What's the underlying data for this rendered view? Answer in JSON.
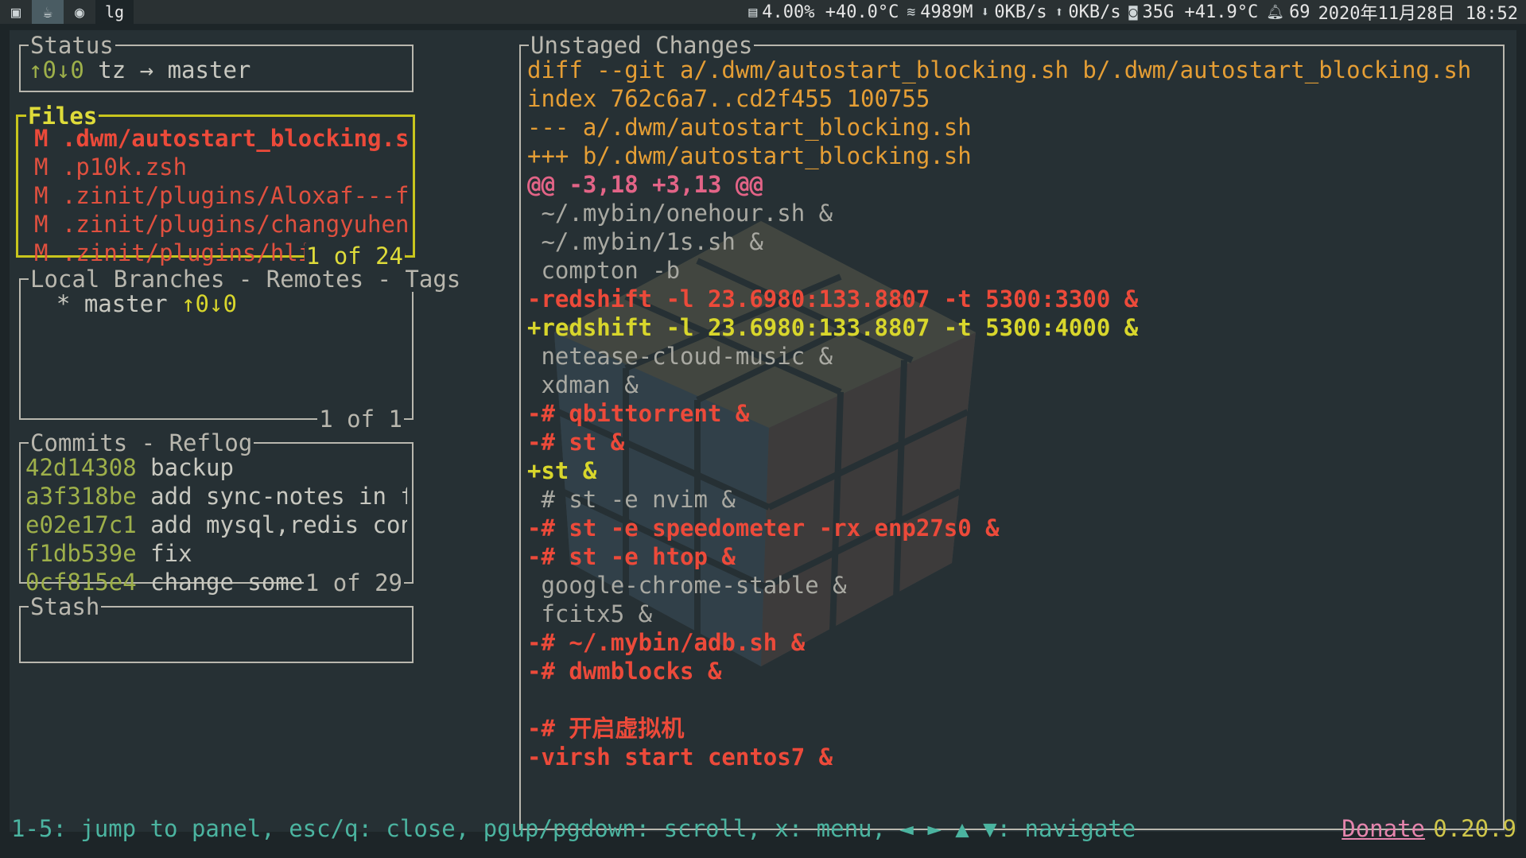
{
  "topbar": {
    "tags": [
      {
        "icon": "terminal-icon",
        "glyph": "▣"
      },
      {
        "icon": "coffee-icon",
        "glyph": "☕"
      },
      {
        "icon": "eye-icon",
        "glyph": "◉"
      }
    ],
    "window_title": "lg",
    "cpu": "4.00% +40.0°C",
    "mem": "4989M",
    "down": "0KB/s",
    "up": "0KB/s",
    "disk": "35G +41.9°C",
    "notify": "69",
    "datetime": "2020年11月28日 18:52"
  },
  "status_panel": {
    "title": "Status",
    "line": "↑0↓0 tz → master"
  },
  "files_panel": {
    "title": "Files",
    "footer": "1 of 24",
    "items": [
      {
        "status": "M",
        "path": ".dwm/autostart_blocking.sh",
        "selected": true
      },
      {
        "status": "M",
        "path": ".p10k.zsh"
      },
      {
        "status": "M",
        "path": ".zinit/plugins/Aloxaf---fzf-ta"
      },
      {
        "status": "M",
        "path": ".zinit/plugins/changyuheng---z"
      },
      {
        "status": "M",
        "path": ".zinit/plugins/hlissner---zsh-"
      }
    ]
  },
  "branches_panel": {
    "title": "Local Branches - Remotes - Tags",
    "footer": "1 of 1",
    "branch": "  * master ",
    "branch_track": "↑0↓0"
  },
  "commits_panel": {
    "title": "Commits - Reflog",
    "footer": "1 of 29",
    "items": [
      {
        "hash": "42d14308",
        "msg": " backup"
      },
      {
        "hash": "a3f318be",
        "msg": " add sync-notes in functi"
      },
      {
        "hash": "e02e17c1",
        "msg": " add mysql,redis configur"
      },
      {
        "hash": "f1db539e",
        "msg": " fix"
      },
      {
        "hash": "0cf815e4",
        "msg": " change something"
      }
    ]
  },
  "stash_panel": {
    "title": "Stash"
  },
  "diff_panel": {
    "title": "Unstaged Changes",
    "lines": [
      {
        "type": "header",
        "text": "diff --git a/.dwm/autostart_blocking.sh b/.dwm/autostart_blocking.sh"
      },
      {
        "type": "header",
        "text": "index 762c6a7..cd2f455 100755"
      },
      {
        "type": "header",
        "text": "--- a/.dwm/autostart_blocking.sh"
      },
      {
        "type": "header",
        "text": "+++ b/.dwm/autostart_blocking.sh"
      },
      {
        "type": "hunk",
        "text": "@@ -3,18 +3,13 @@"
      },
      {
        "type": "context",
        "text": " ~/.mybin/onehour.sh &"
      },
      {
        "type": "context",
        "text": " ~/.mybin/1s.sh &"
      },
      {
        "type": "context",
        "text": " compton -b"
      },
      {
        "type": "removed",
        "text": "-redshift -l 23.6980:133.8807 -t 5300:3300 &"
      },
      {
        "type": "added",
        "text": "+redshift -l 23.6980:133.8807 -t 5300:4000 &"
      },
      {
        "type": "context",
        "text": " netease-cloud-music &"
      },
      {
        "type": "context",
        "text": " xdman &"
      },
      {
        "type": "removed",
        "text": "-# qbittorrent &"
      },
      {
        "type": "removed",
        "text": "-# st &"
      },
      {
        "type": "added",
        "text": "+st &"
      },
      {
        "type": "context",
        "text": " # st -e nvim &"
      },
      {
        "type": "removed",
        "text": "-# st -e speedometer -rx enp27s0 &"
      },
      {
        "type": "removed",
        "text": "-# st -e htop &"
      },
      {
        "type": "context",
        "text": " google-chrome-stable &"
      },
      {
        "type": "context",
        "text": " fcitx5 &"
      },
      {
        "type": "removed",
        "text": "-# ~/.mybin/adb.sh &"
      },
      {
        "type": "removed",
        "text": "-# dwmblocks &"
      },
      {
        "type": "context",
        "text": " "
      },
      {
        "type": "removed",
        "text": "-# 开启虚拟机"
      },
      {
        "type": "removed",
        "text": "-virsh start centos7 &"
      }
    ]
  },
  "bottombar": {
    "help": "1-5: jump to panel, esc/q: close, pgup/pgdown: scroll, x: menu, ◄ ► ▲ ▼: navigate",
    "donate": "Donate",
    "version": "0.20.9"
  },
  "colors": {
    "background": "#263034",
    "active_border": "#c8c51d",
    "removed": "#ec4a3a",
    "added": "#d8d62c",
    "diff_header": "#e59e35",
    "hunk": "#e36487",
    "hash": "#9eb04a"
  }
}
